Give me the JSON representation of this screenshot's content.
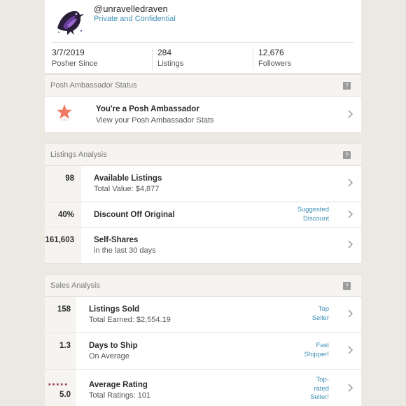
{
  "profile": {
    "username": "@unravelledraven",
    "subtitle": "Private and Confidential",
    "stats": [
      {
        "value": "3/7/2019",
        "label": "Posher Since"
      },
      {
        "value": "284",
        "label": "Listings"
      },
      {
        "value": "12,676",
        "label": "Followers"
      }
    ]
  },
  "ambassador": {
    "header": "Posh Ambassador Status",
    "title": "You're a Posh Ambassador",
    "subtitle": "View your Posh Ambassador Stats"
  },
  "listings": {
    "header": "Listings Analysis",
    "rows": [
      {
        "value": "98",
        "title": "Available Listings",
        "subtitle": "Total Value: $4,877"
      },
      {
        "value": "40%",
        "title": "Discount Off Original",
        "badge_line1": "Suggested",
        "badge_line2": "Discount"
      },
      {
        "value": "161,603",
        "title": "Self-Shares",
        "subtitle": "in the last 30 days"
      }
    ]
  },
  "sales": {
    "header": "Sales Analysis",
    "rows": [
      {
        "value": "158",
        "title": "Listings Sold",
        "subtitle": "Total Earned: $2,554.19",
        "badge_line1": "Top",
        "badge_line2": "Seller"
      },
      {
        "value": "1.3",
        "title": "Days to Ship",
        "subtitle": "On Average",
        "badge_line1": "Fast",
        "badge_line2": "Shipper!"
      },
      {
        "value": "5.0",
        "stars": "★★★★★",
        "title": "Average Rating",
        "subtitle": "Total Ratings: 101",
        "badge_line1": "Top-",
        "badge_line2": "rated",
        "badge_line3": "Seller!"
      }
    ]
  },
  "help_icon": "?",
  "colors": {
    "accent_blue": "#3e8fb5",
    "star_coral": "#f07a63",
    "rating_star": "#8a1f2d"
  }
}
